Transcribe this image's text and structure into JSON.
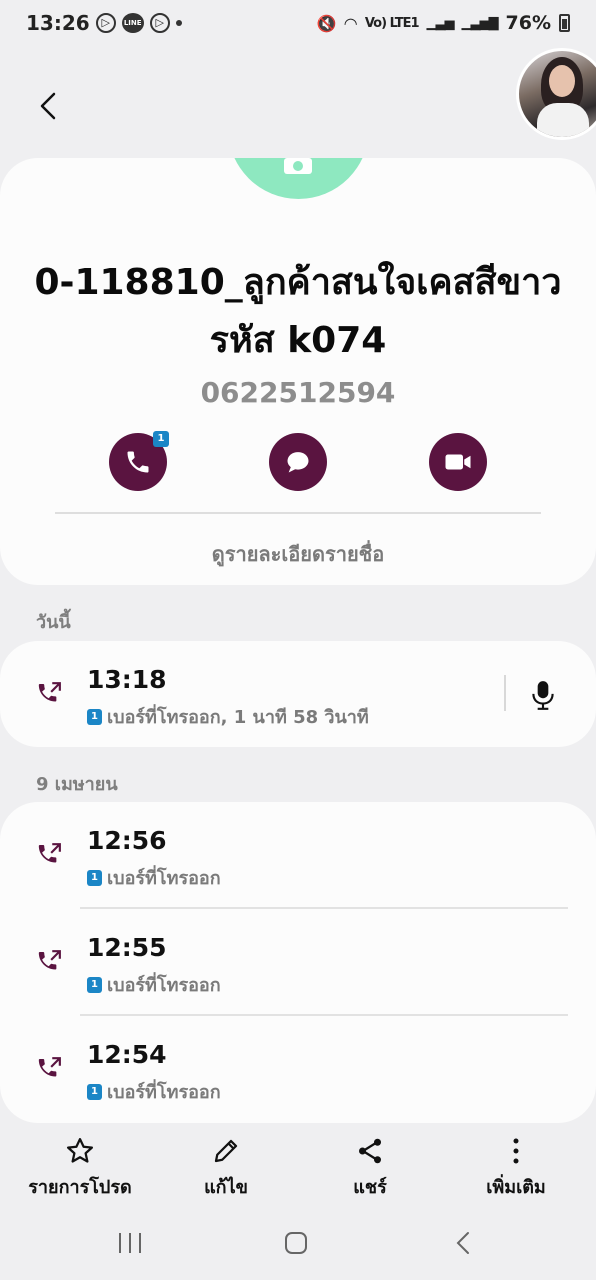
{
  "status_bar": {
    "time": "13:26",
    "line_label": "LINE",
    "network_label": "Vo) LTE1",
    "battery": "76%"
  },
  "contact": {
    "name": "0-118810_ลูกค้าสนใจเคสสีขาวรหัส k074",
    "number": "0622512594",
    "call_badge": "1",
    "view_details_label": "ดูรายละเอียดรายชื่อ"
  },
  "sections": {
    "today_label": "วันนี้",
    "date_label": "9 เมษายน"
  },
  "today_calls": [
    {
      "time": "13:18",
      "sim": "1",
      "detail": "เบอร์ที่โทรออก, 1 นาที 58 วินาที"
    }
  ],
  "earlier_calls": [
    {
      "time": "12:56",
      "sim": "1",
      "detail": "เบอร์ที่โทรออก"
    },
    {
      "time": "12:55",
      "sim": "1",
      "detail": "เบอร์ที่โทรออก"
    },
    {
      "time": "12:54",
      "sim": "1",
      "detail": "เบอร์ที่โทรออก"
    }
  ],
  "bottom_bar": {
    "favorite_label": "รายการโปรด",
    "edit_label": "แก้ไข",
    "share_label": "แชร์",
    "more_label": "เพิ่มเติม"
  },
  "colors": {
    "accent": "#5a1440",
    "photo_bg": "#8ee8c0",
    "sim_badge": "#1b86c6"
  },
  "icons": {
    "call": "phone-icon",
    "message": "message-icon",
    "video": "video-icon",
    "outgoing_call": "outgoing-call-icon",
    "recording": "mic-icon",
    "favorite": "star-icon",
    "edit": "pencil-icon",
    "share": "share-icon",
    "more": "more-vertical-icon"
  }
}
